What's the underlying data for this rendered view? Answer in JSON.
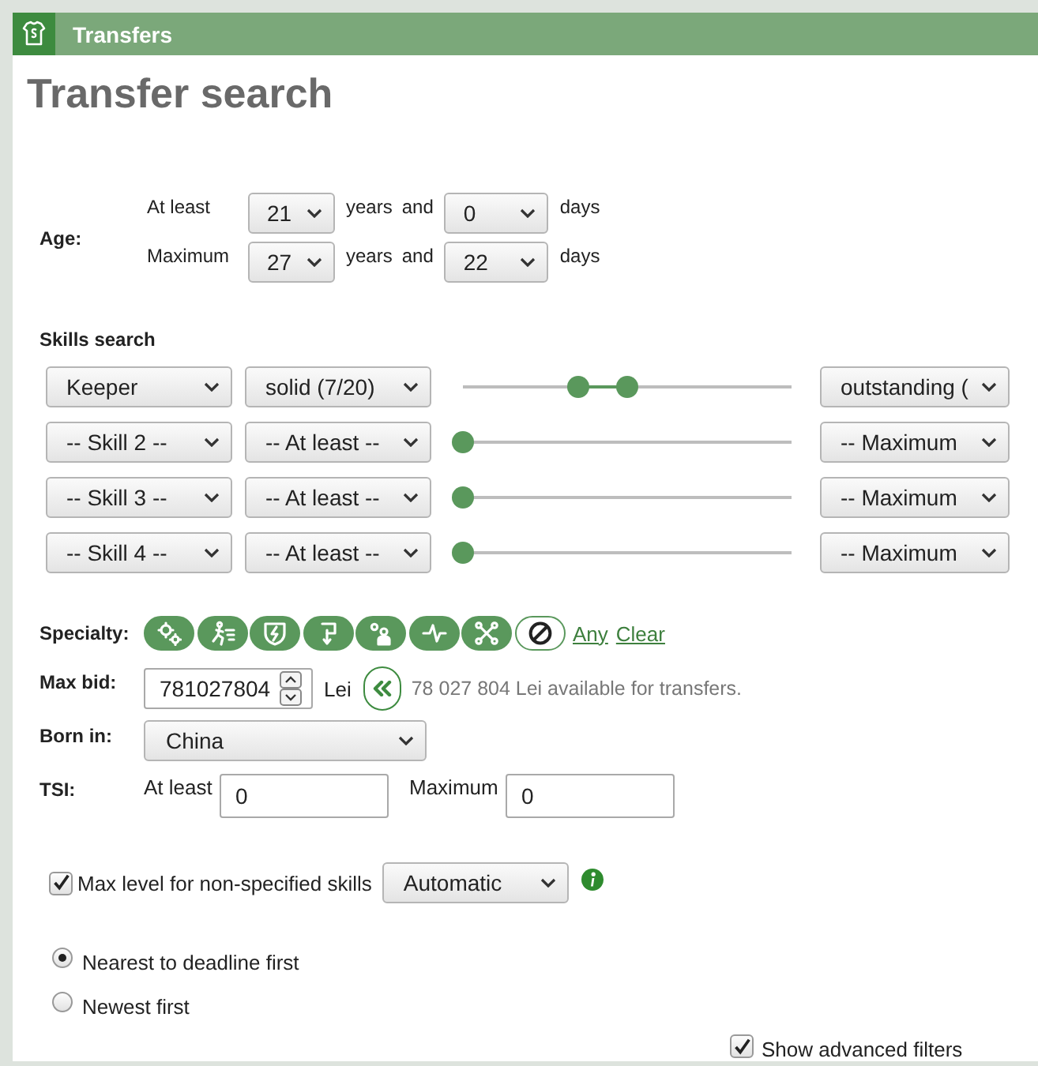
{
  "header": {
    "title": "Transfers"
  },
  "heading": "Transfer search",
  "age": {
    "label": "Age:",
    "rows": [
      {
        "label": "At least",
        "years": "21",
        "years_label": "years",
        "and_label": "and",
        "days": "0",
        "days_label": "days"
      },
      {
        "label": "Maximum",
        "years": "27",
        "years_label": "years",
        "and_label": "and",
        "days": "22",
        "days_label": "days"
      }
    ]
  },
  "skills": {
    "title": "Skills search",
    "rows": [
      {
        "skill": "Keeper",
        "minimum": "solid (7/20)",
        "thumbs": [
          {
            "level": 0.35
          },
          {
            "level": 0.5
          }
        ],
        "maximum": "outstanding ("
      },
      {
        "skill": "-- Skill 2 --",
        "minimum": "-- At least --",
        "thumbs": [
          {
            "level": 0
          }
        ],
        "maximum": "-- Maximum"
      },
      {
        "skill": "-- Skill 3 --",
        "minimum": "-- At least --",
        "thumbs": [
          {
            "level": 0
          }
        ],
        "maximum": "-- Maximum"
      },
      {
        "skill": "-- Skill 4 --",
        "minimum": "-- At least --",
        "thumbs": [
          {
            "level": 0
          }
        ],
        "maximum": "-- Maximum"
      }
    ]
  },
  "specialty": {
    "label": "Specialty:",
    "buttons": [
      {
        "kind": "technical",
        "selected": true
      },
      {
        "kind": "quick",
        "selected": true
      },
      {
        "kind": "powerful",
        "selected": true
      },
      {
        "kind": "unpredictable",
        "selected": true
      },
      {
        "kind": "head",
        "selected": true
      },
      {
        "kind": "resilient",
        "selected": true
      },
      {
        "kind": "support",
        "selected": true
      },
      {
        "kind": "none",
        "selected": false
      }
    ],
    "links": [
      "Any",
      "Clear"
    ]
  },
  "max_bid": {
    "label": "Max bid:",
    "value": "781027804",
    "currency": "Lei",
    "note": "78 027 804 Lei available for transfers."
  },
  "born_in": {
    "label": "Born in:",
    "value": "China"
  },
  "tsi": {
    "label": "TSI:",
    "min_label": "At least",
    "min": "0",
    "max_label": "Maximum",
    "max": "0"
  },
  "max_level": {
    "checked": true,
    "label": "Max level for non-specified skills",
    "value": "Automatic"
  },
  "sort": [
    {
      "label": "Nearest to deadline first",
      "selected": true
    },
    {
      "label": "Newest first",
      "selected": false
    }
  ],
  "advanced": {
    "checked": true,
    "label": "Show advanced filters"
  }
}
